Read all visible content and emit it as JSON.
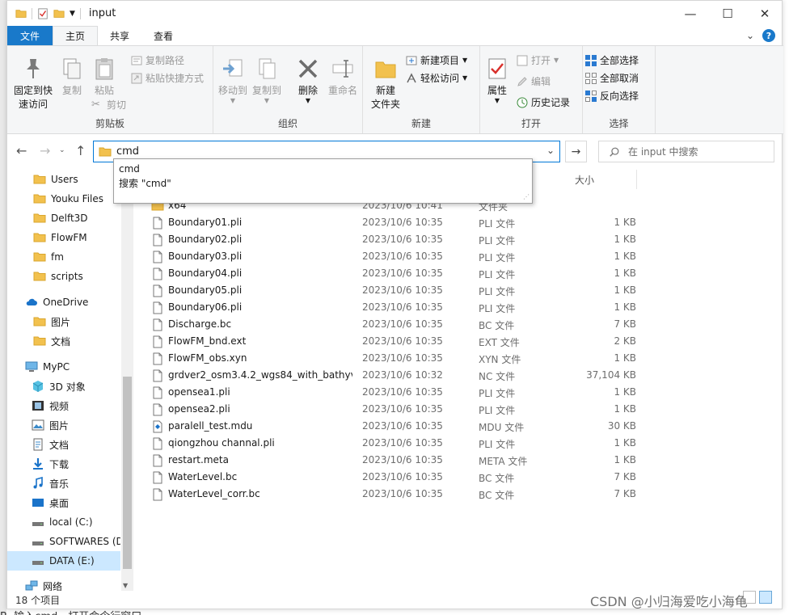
{
  "window": {
    "title": "input"
  },
  "tabs": [
    {
      "label": "文件"
    },
    {
      "label": "主页"
    },
    {
      "label": "共享"
    },
    {
      "label": "查看"
    }
  ],
  "help_glyph": "?",
  "ribbon": {
    "clipboard": {
      "label": "剪贴板",
      "pin": "固定到快\n速访问",
      "copy": "复制",
      "paste": "粘贴",
      "copy_path": "复制路径",
      "paste_shortcut": "粘贴快捷方式",
      "cut": "剪切"
    },
    "organize": {
      "label": "组织",
      "move_to": "移动到",
      "copy_to": "复制到",
      "delete": "删除",
      "rename": "重命名"
    },
    "new": {
      "label": "新建",
      "new_folder": "新建\n文件夹",
      "new_item": "新建项目",
      "easy_access": "轻松访问"
    },
    "open": {
      "label": "打开",
      "properties": "属性",
      "open": "打开",
      "edit": "编辑",
      "history": "历史记录"
    },
    "select": {
      "label": "选择",
      "select_all": "全部选择",
      "select_none": "全部取消",
      "invert": "反向选择"
    }
  },
  "address": {
    "value": "cmd"
  },
  "search": {
    "placeholder": "在 input 中搜索"
  },
  "suggestions": [
    "cmd",
    "搜索 \"cmd\""
  ],
  "nav": [
    {
      "label": "Users",
      "icon": "folder-icon"
    },
    {
      "label": "Youku Files",
      "icon": "folder-icon"
    },
    {
      "label": "Delft3D",
      "icon": "folder-icon"
    },
    {
      "label": "FlowFM",
      "icon": "folder-icon"
    },
    {
      "label": "fm",
      "icon": "folder-icon"
    },
    {
      "label": "scripts",
      "icon": "folder-icon"
    },
    {
      "label": "OneDrive",
      "icon": "cloud-icon"
    },
    {
      "label": "图片",
      "icon": "folder-icon"
    },
    {
      "label": "文档",
      "icon": "folder-icon"
    },
    {
      "label": "MyPC",
      "icon": "pc-icon"
    },
    {
      "label": "3D 对象",
      "icon": "cube-icon"
    },
    {
      "label": "视频",
      "icon": "video-icon"
    },
    {
      "label": "图片",
      "icon": "picture-icon"
    },
    {
      "label": "文档",
      "icon": "document-icon"
    },
    {
      "label": "下载",
      "icon": "download-icon"
    },
    {
      "label": "音乐",
      "icon": "music-icon"
    },
    {
      "label": "桌面",
      "icon": "desktop-icon"
    },
    {
      "label": "local (C:)",
      "icon": "drive-icon"
    },
    {
      "label": "SOFTWARES (D:",
      "icon": "drive-icon"
    },
    {
      "label": "DATA (E:)",
      "icon": "drive-icon"
    },
    {
      "label": "网络",
      "icon": "network-icon"
    }
  ],
  "columns": {
    "size": "大小"
  },
  "files": [
    {
      "name": "x64",
      "date": "2023/10/6 10:41",
      "type": "文件夹",
      "size": "",
      "icon": "folder-icon"
    },
    {
      "name": "Boundary01.pli",
      "date": "2023/10/6 10:35",
      "type": "PLI 文件",
      "size": "1 KB",
      "icon": "file-icon"
    },
    {
      "name": "Boundary02.pli",
      "date": "2023/10/6 10:35",
      "type": "PLI 文件",
      "size": "1 KB",
      "icon": "file-icon"
    },
    {
      "name": "Boundary03.pli",
      "date": "2023/10/6 10:35",
      "type": "PLI 文件",
      "size": "1 KB",
      "icon": "file-icon"
    },
    {
      "name": "Boundary04.pli",
      "date": "2023/10/6 10:35",
      "type": "PLI 文件",
      "size": "1 KB",
      "icon": "file-icon"
    },
    {
      "name": "Boundary05.pli",
      "date": "2023/10/6 10:35",
      "type": "PLI 文件",
      "size": "1 KB",
      "icon": "file-icon"
    },
    {
      "name": "Boundary06.pli",
      "date": "2023/10/6 10:35",
      "type": "PLI 文件",
      "size": "1 KB",
      "icon": "file-icon"
    },
    {
      "name": "Discharge.bc",
      "date": "2023/10/6 10:35",
      "type": "BC 文件",
      "size": "7 KB",
      "icon": "file-icon"
    },
    {
      "name": "FlowFM_bnd.ext",
      "date": "2023/10/6 10:35",
      "type": "EXT 文件",
      "size": "2 KB",
      "icon": "file-icon"
    },
    {
      "name": "FlowFM_obs.xyn",
      "date": "2023/10/6 10:35",
      "type": "XYN 文件",
      "size": "1 KB",
      "icon": "file-icon"
    },
    {
      "name": "grdver2_osm3.4.2_wgs84_with_bathyv...",
      "date": "2023/10/6 10:32",
      "type": "NC 文件",
      "size": "37,104 KB",
      "icon": "file-icon"
    },
    {
      "name": "opensea1.pli",
      "date": "2023/10/6 10:35",
      "type": "PLI 文件",
      "size": "1 KB",
      "icon": "file-icon"
    },
    {
      "name": "opensea2.pli",
      "date": "2023/10/6 10:35",
      "type": "PLI 文件",
      "size": "1 KB",
      "icon": "file-icon"
    },
    {
      "name": "paralell_test.mdu",
      "date": "2023/10/6 10:35",
      "type": "MDU 文件",
      "size": "30 KB",
      "icon": "mdu-icon"
    },
    {
      "name": "qiongzhou channal.pli",
      "date": "2023/10/6 10:35",
      "type": "PLI 文件",
      "size": "1 KB",
      "icon": "file-icon"
    },
    {
      "name": "restart.meta",
      "date": "2023/10/6 10:35",
      "type": "META 文件",
      "size": "1 KB",
      "icon": "file-icon"
    },
    {
      "name": "WaterLevel.bc",
      "date": "2023/10/6 10:35",
      "type": "BC 文件",
      "size": "7 KB",
      "icon": "file-icon"
    },
    {
      "name": "WaterLevel_corr.bc",
      "date": "2023/10/6 10:35",
      "type": "BC 文件",
      "size": "7 KB",
      "icon": "file-icon"
    }
  ],
  "status": {
    "item_count": "18 个项目"
  },
  "watermark": "CSDN @小归海爱吃小海龟",
  "caption": "B. 输入cmd，打开命令行窗口"
}
